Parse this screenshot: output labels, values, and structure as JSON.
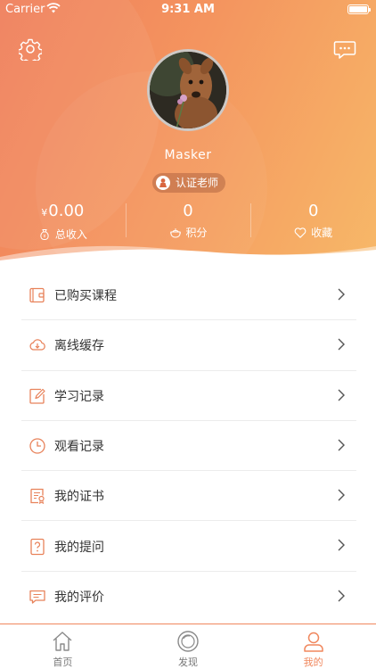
{
  "status_bar": {
    "carrier": "Carrier",
    "time": "9:31 AM"
  },
  "profile": {
    "username": "Masker",
    "badge": "认证老师"
  },
  "stats": [
    {
      "currency": "¥",
      "value": "0.00",
      "label": "总收入",
      "icon": "money-bag-icon"
    },
    {
      "value": "0",
      "label": "积分",
      "icon": "points-pot-icon"
    },
    {
      "value": "0",
      "label": "收藏",
      "icon": "heart-icon"
    }
  ],
  "menu": [
    {
      "label": "已购买课程",
      "icon": "wallet-icon"
    },
    {
      "label": "离线缓存",
      "icon": "cloud-download-icon"
    },
    {
      "label": "学习记录",
      "icon": "edit-note-icon"
    },
    {
      "label": "观看记录",
      "icon": "clock-icon"
    },
    {
      "label": "我的证书",
      "icon": "certificate-icon"
    },
    {
      "label": "我的提问",
      "icon": "question-icon"
    },
    {
      "label": "我的评价",
      "icon": "comment-icon"
    }
  ],
  "tabs": [
    {
      "label": "首页",
      "icon": "home-icon",
      "active": false
    },
    {
      "label": "发现",
      "icon": "discover-icon",
      "active": false
    },
    {
      "label": "我的",
      "icon": "user-icon",
      "active": true
    }
  ],
  "colors": {
    "accent": "#f0875d",
    "gradient_start": "#f07e5b",
    "gradient_end": "#f7b868"
  }
}
